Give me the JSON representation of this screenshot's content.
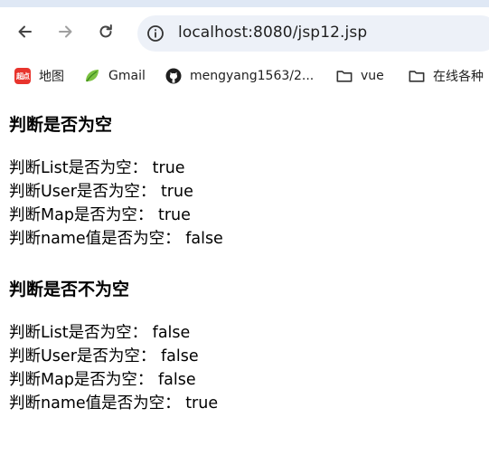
{
  "browser": {
    "url": "localhost:8080/jsp12.jsp",
    "bookmarks": [
      {
        "icon": "baidu-logo-icon",
        "icon_text": "超点",
        "label": "地图"
      },
      {
        "icon": "gmail-leaf-icon",
        "label": "Gmail"
      },
      {
        "icon": "github-icon",
        "label": "mengyang1563/2..."
      },
      {
        "icon": "folder-icon",
        "label": "vue"
      },
      {
        "icon": "folder-icon",
        "label": "在线各种"
      }
    ]
  },
  "page": {
    "section_empty": {
      "heading": "判断是否为空",
      "lines": [
        "判断List是否为空： true",
        "判断User是否为空： true",
        "判断Map是否为空： true",
        "判断name值是否为空： false"
      ]
    },
    "section_not_empty": {
      "heading": "判断是否不为空",
      "lines": [
        "判断List是否为空： false",
        "判断User是否为空： false",
        "判断Map是否为空： false",
        "判断name值是否为空： true"
      ]
    }
  }
}
